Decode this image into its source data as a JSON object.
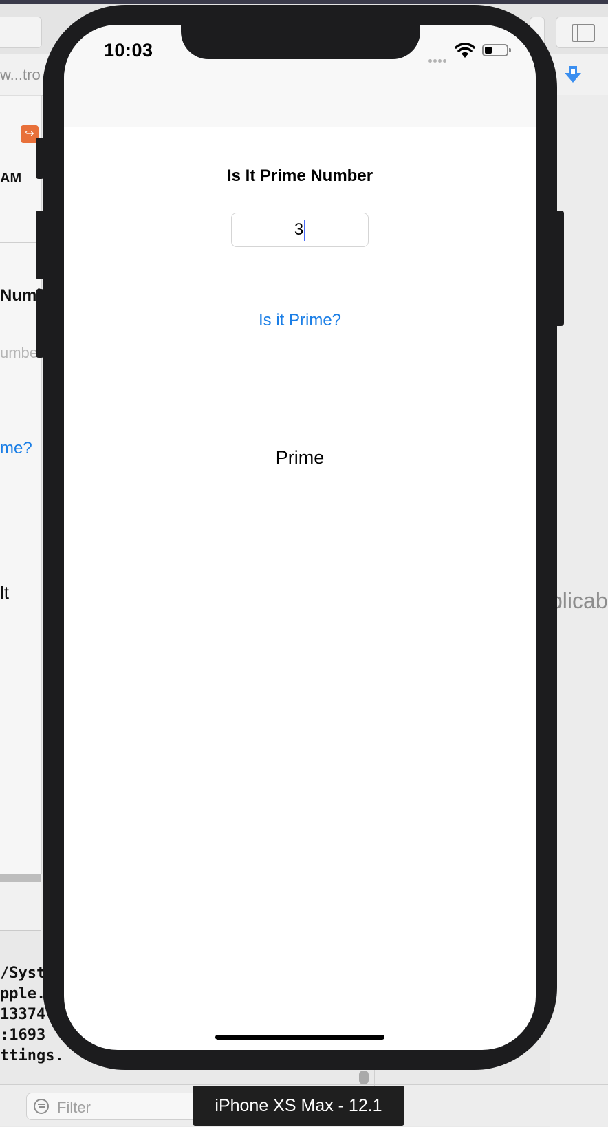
{
  "xcode": {
    "path_fragment": "w...tro",
    "sidebar_fragment_time": "AM",
    "sidebar_fragment_title": "Numl",
    "sidebar_fragment_placeholder": "umbe",
    "sidebar_fragment_button": "me?",
    "sidebar_fragment_result": "lt",
    "inspector_fragment": "plicab",
    "console_lines": [
      "/Syst",
      "pple.",
      "13374",
      ":1693",
      "ttings."
    ],
    "filter_placeholder": "Filter"
  },
  "status_bar": {
    "time": "10:03"
  },
  "app": {
    "title": "Is It Prime Number",
    "number_value": "3",
    "button_label": "Is it Prime?",
    "result": "Prime"
  },
  "simulator": {
    "device_label": "iPhone XS Max - 12.1"
  },
  "colors": {
    "tint": "#1a7ee6",
    "device_frame": "#1c1c1e"
  }
}
